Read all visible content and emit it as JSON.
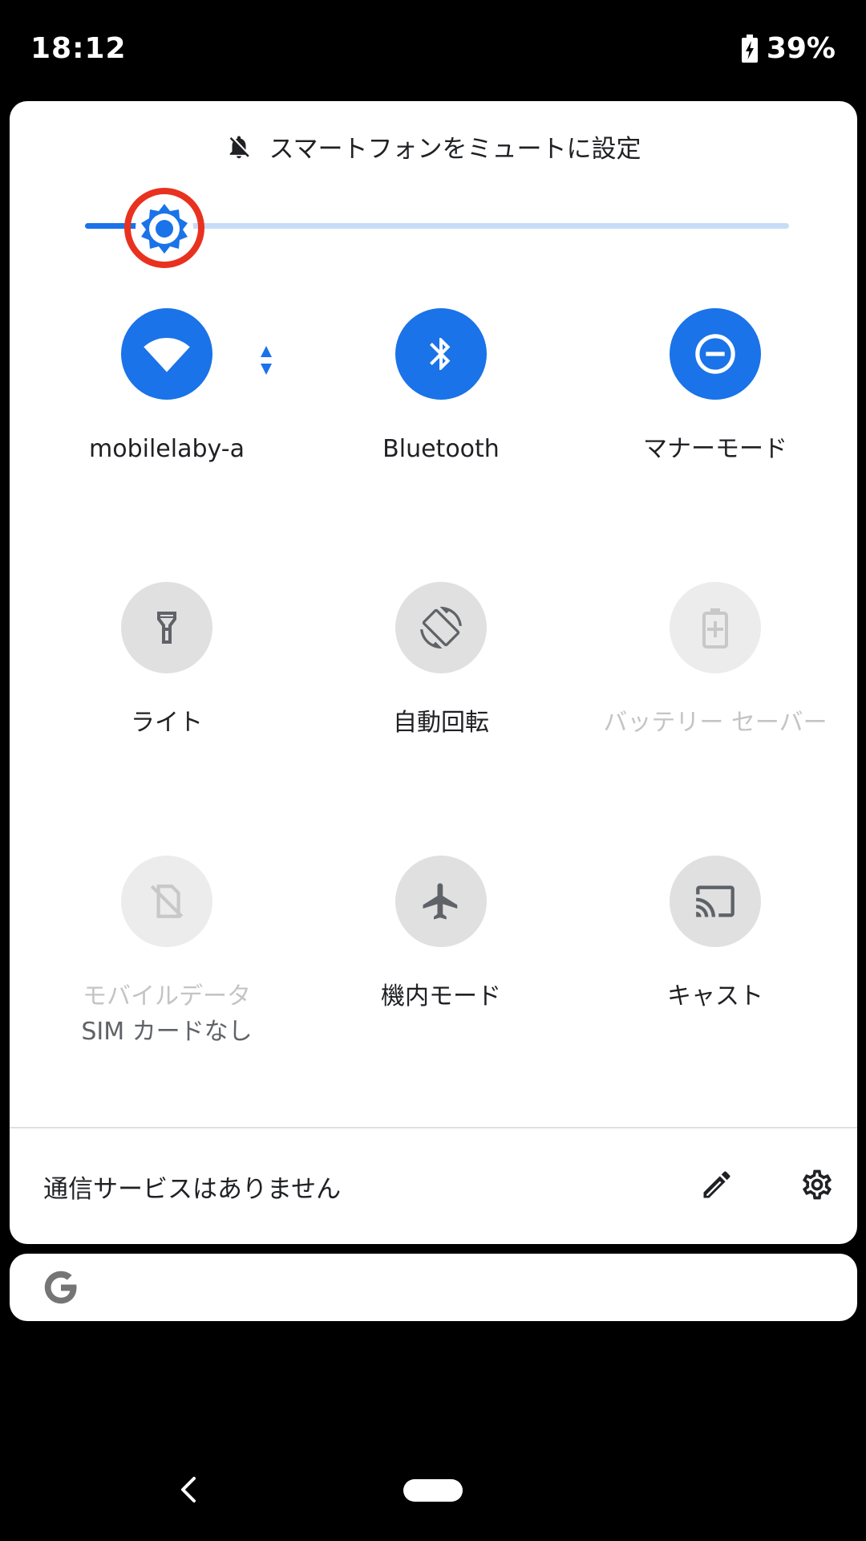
{
  "status_bar": {
    "time": "18:12",
    "battery_percent": "39%",
    "battery_level": 0.39
  },
  "mute": {
    "label": "スマートフォンをミュートに設定",
    "icon": "bell-off-icon"
  },
  "brightness": {
    "level": 0.11,
    "icon": "brightness-icon"
  },
  "tiles": [
    {
      "label": "mobilelaby-a",
      "icon": "wifi-icon",
      "state": "active"
    },
    {
      "label": "Bluetooth",
      "icon": "bluetooth-icon",
      "state": "active"
    },
    {
      "label": "マナーモード",
      "icon": "do-not-disturb-icon",
      "state": "active"
    },
    {
      "label": "ライト",
      "icon": "flashlight-icon",
      "state": "inactive"
    },
    {
      "label": "自動回転",
      "icon": "auto-rotate-icon",
      "state": "inactive"
    },
    {
      "label": "バッテリー セーバー",
      "icon": "battery-saver-icon",
      "state": "disabled"
    },
    {
      "label": "モバイルデータ",
      "sublabel": "SIM カードなし",
      "icon": "mobile-data-icon",
      "state": "disabled"
    },
    {
      "label": "機内モード",
      "icon": "airplane-icon",
      "state": "inactive"
    },
    {
      "label": "キャスト",
      "icon": "cast-icon",
      "state": "inactive"
    }
  ],
  "footer": {
    "carrier_text": "通信サービスはありません",
    "edit_icon": "pencil-icon",
    "settings_icon": "gear-icon"
  },
  "search": {
    "icon": "google-icon"
  },
  "colors": {
    "accent": "#1a73e8",
    "inactive_tile": "#e0e0e0",
    "highlight_ring": "#e8321f"
  },
  "nav": {
    "back_icon": "back-chevron-icon",
    "home_icon": "home-pill-icon"
  }
}
